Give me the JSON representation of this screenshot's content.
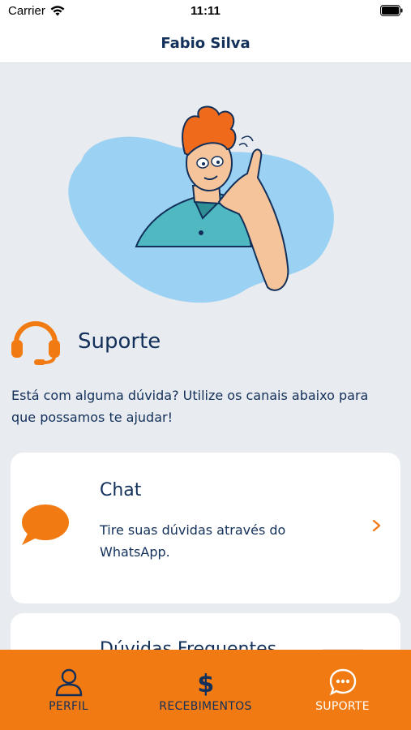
{
  "status_bar": {
    "carrier": "Carrier",
    "time": "11:11"
  },
  "nav": {
    "title": "Fabio Silva"
  },
  "support": {
    "title": "Suporte",
    "intro": "Está com alguma dúvida? Utilize os canais abaixo para que possamos te ajudar!"
  },
  "cards": {
    "chat": {
      "title": "Chat",
      "description": "Tire suas dúvidas através do WhatsApp."
    },
    "faq": {
      "title": "Dúvidas Frequentes"
    }
  },
  "tabs": [
    {
      "label": "PERFIL",
      "icon": "person-icon"
    },
    {
      "label": "RECEBIMENTOS",
      "icon": "dollar-icon"
    },
    {
      "label": "SUPORTE",
      "icon": "chat-bubble-icon",
      "active": true
    }
  ],
  "colors": {
    "accent": "#f27a12",
    "text": "#12305a",
    "background": "#e8ebef"
  }
}
